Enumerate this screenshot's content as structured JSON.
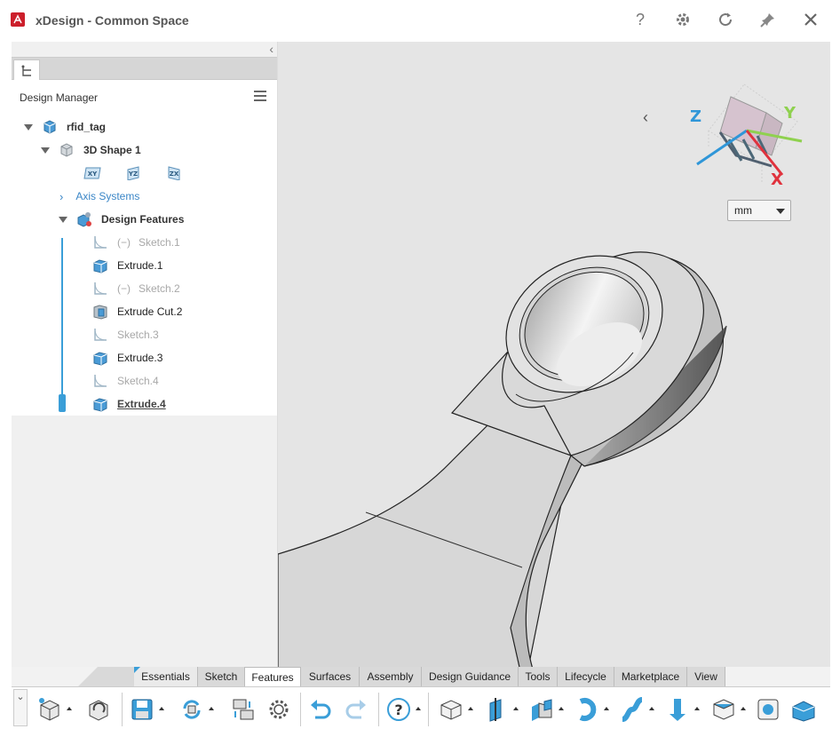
{
  "window": {
    "title": "xDesign - Common Space",
    "buttons": [
      "help",
      "settings",
      "refresh",
      "pin",
      "close"
    ]
  },
  "colors": {
    "accent": "#3a9ed8",
    "brand_red": "#cc1f2b",
    "axis_x": "#e0323d",
    "axis_y": "#8fd14f",
    "axis_z": "#2f96d8"
  },
  "panel": {
    "tab_icon": "tree-icon",
    "header": "Design Manager",
    "tree": {
      "root": "rfid_tag",
      "shape": "3D Shape 1",
      "planes": [
        "XY",
        "YZ",
        "ZX"
      ],
      "axis_systems": "Axis Systems",
      "design_features": "Design Features",
      "features": [
        {
          "label": "Sketch.1",
          "kind": "sketch",
          "suppressed": true
        },
        {
          "label": "Extrude.1",
          "kind": "extrude",
          "suppressed": false
        },
        {
          "label": "Sketch.2",
          "kind": "sketch",
          "suppressed": true
        },
        {
          "label": "Extrude Cut.2",
          "kind": "extrude-cut",
          "suppressed": false
        },
        {
          "label": "Sketch.3",
          "kind": "sketch-hidden",
          "suppressed": false
        },
        {
          "label": "Extrude.3",
          "kind": "extrude",
          "suppressed": false
        },
        {
          "label": "Sketch.4",
          "kind": "sketch-hidden",
          "suppressed": false
        },
        {
          "label": "Extrude.4",
          "kind": "extrude",
          "suppressed": false,
          "current": true
        }
      ],
      "suppressed_prefix": "(−)"
    }
  },
  "viewport": {
    "units": "mm",
    "axes": {
      "x": "X",
      "y": "Y",
      "z": "Z"
    }
  },
  "command_tabs": [
    "Essentials",
    "Sketch",
    "Features",
    "Surfaces",
    "Assembly",
    "Design Guidance",
    "Tools",
    "Lifecycle",
    "Marketplace",
    "View"
  ],
  "active_tab": "Features",
  "toolbar": {
    "tools": [
      "new-part-icon",
      "rebuild-icon",
      "save-icon",
      "sync-icon",
      "replace-icon",
      "gear-icon",
      "undo-icon",
      "redo-icon",
      "help-icon",
      "extrude-icon",
      "plane-icon",
      "boss-icon",
      "revolve-icon",
      "sweep-icon",
      "pull-icon",
      "shell-icon",
      "hole-icon",
      "fillet-icon"
    ]
  }
}
